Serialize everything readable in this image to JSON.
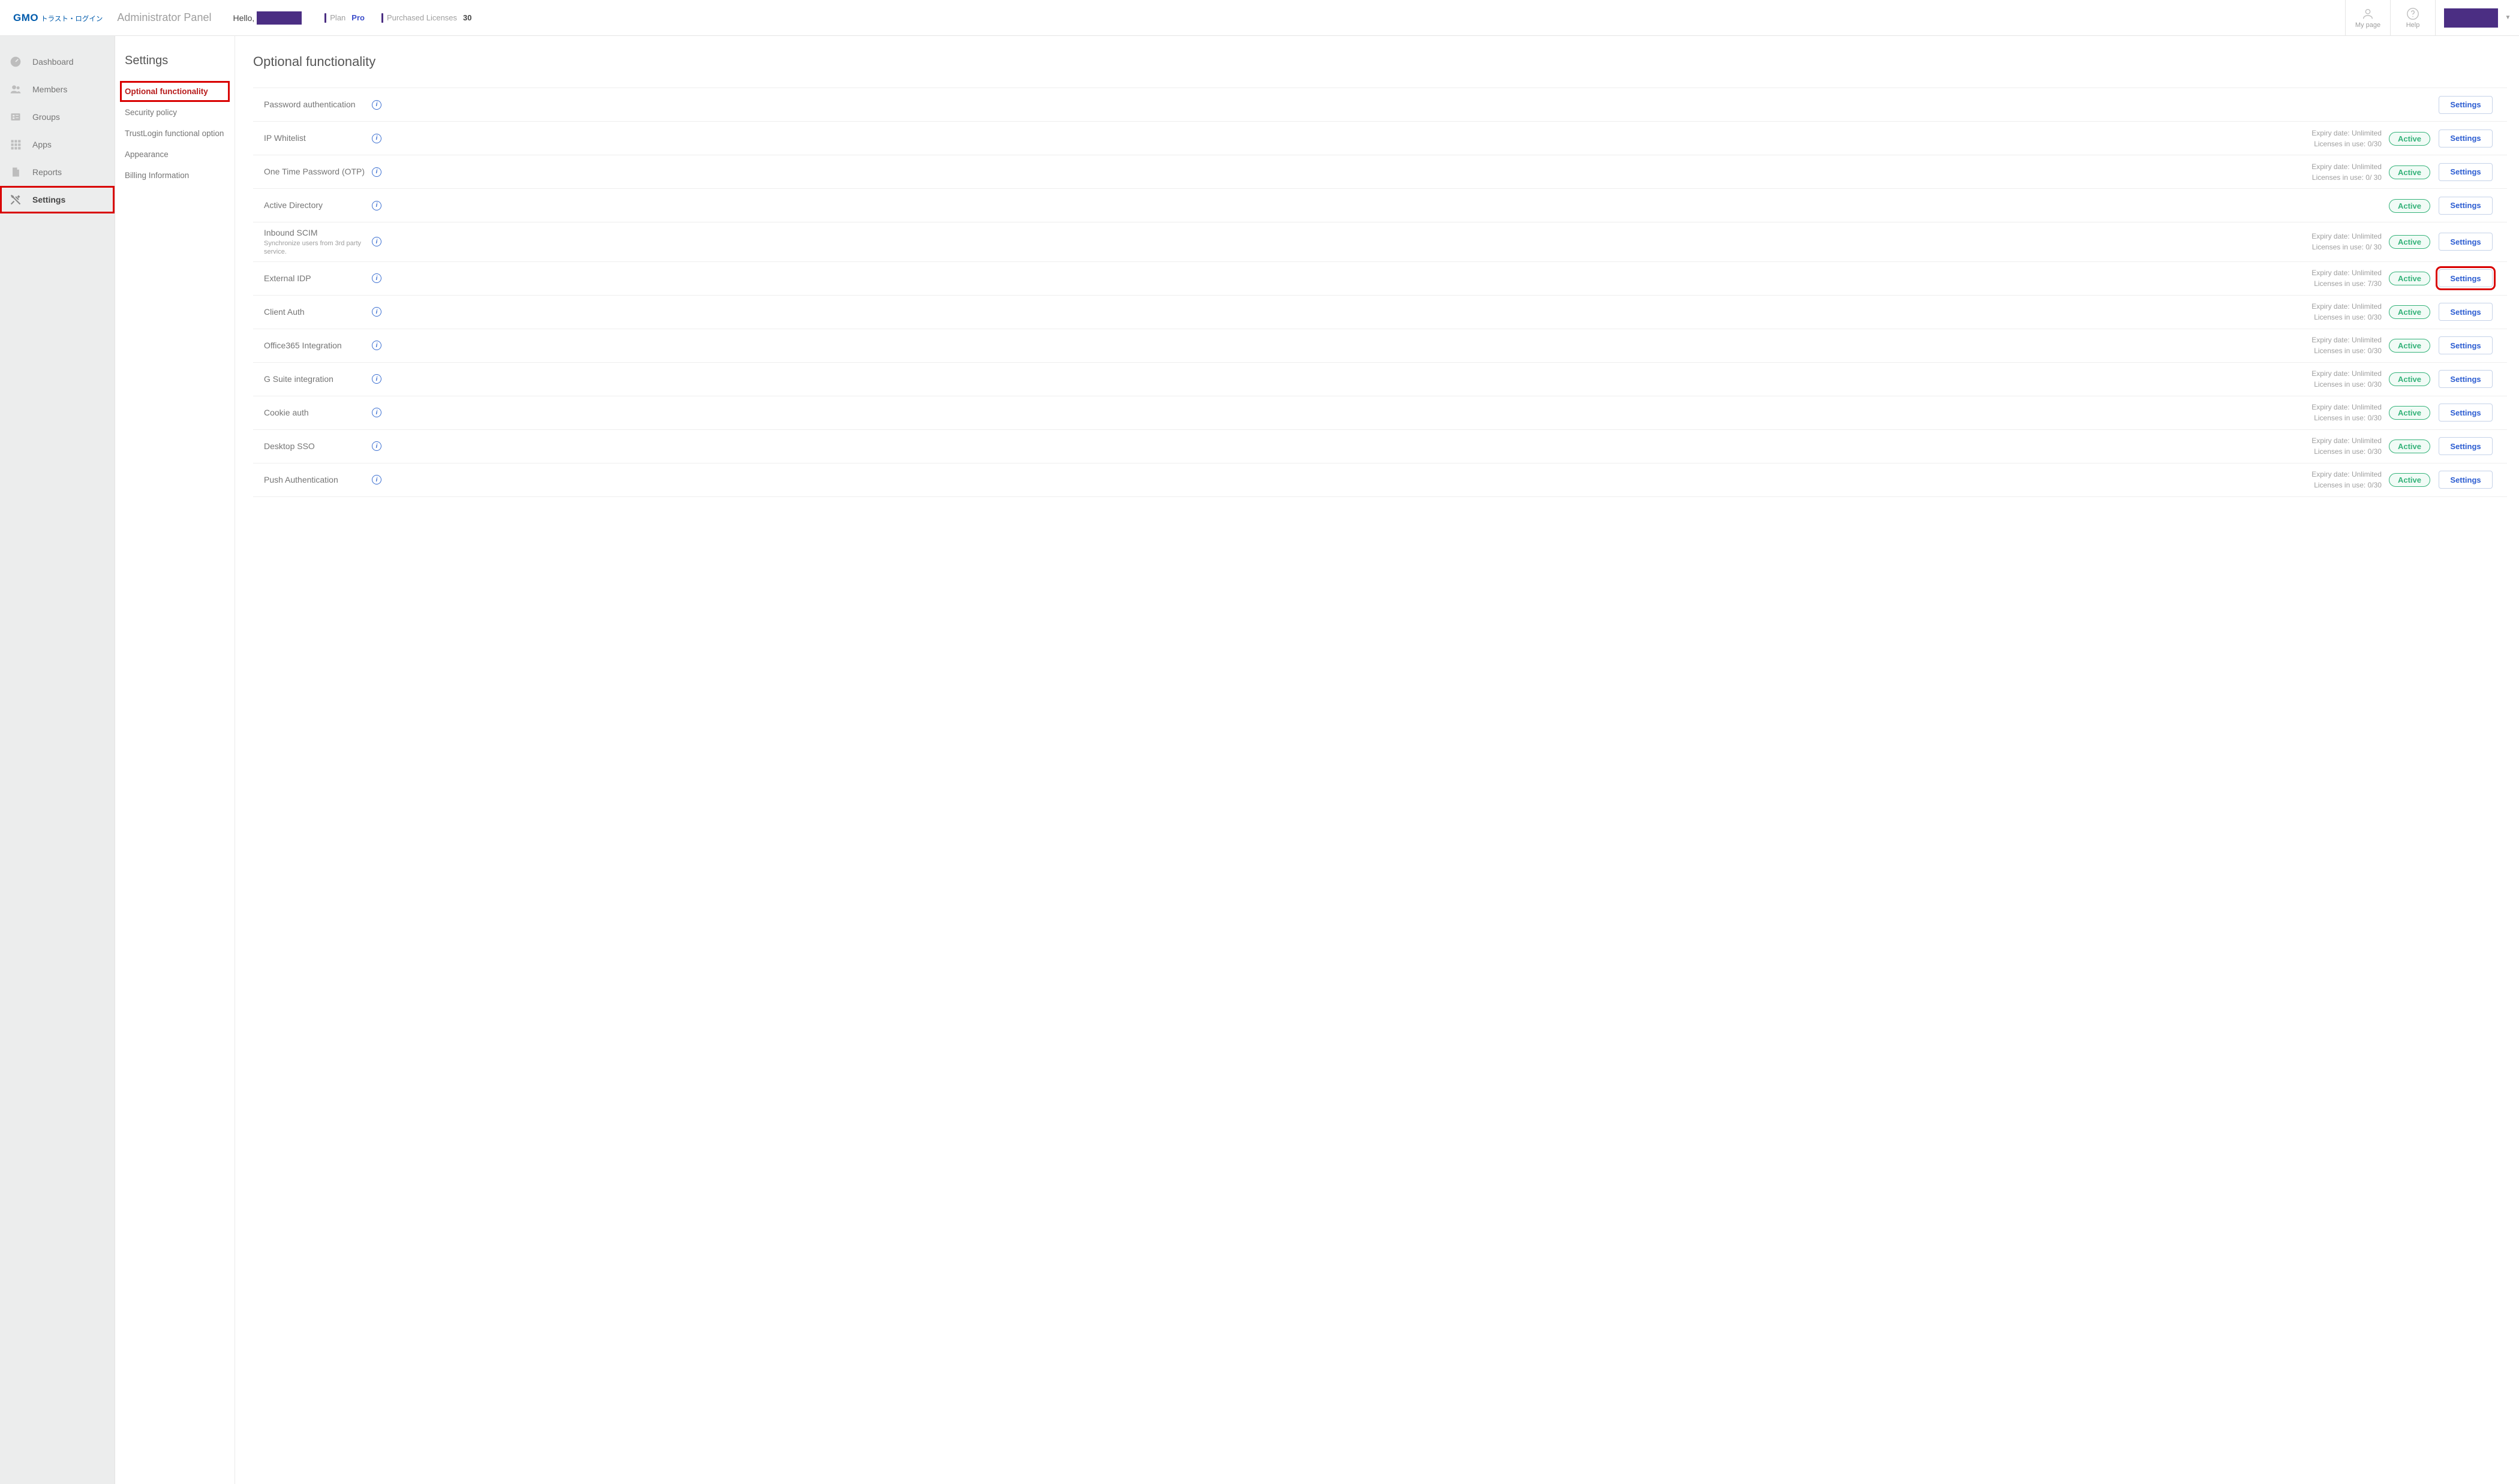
{
  "header": {
    "logo_gmo": "GMO",
    "logo_trust": "トラスト・ログイン",
    "admin_panel": "Administrator Panel",
    "hello": "Hello,",
    "plan_label": "Plan",
    "plan_value": "Pro",
    "licenses_label": "Purchased Licenses",
    "licenses_value": "30",
    "mypage": "My page",
    "help": "Help"
  },
  "nav": {
    "items": [
      {
        "label": "Dashboard"
      },
      {
        "label": "Members"
      },
      {
        "label": "Groups"
      },
      {
        "label": "Apps"
      },
      {
        "label": "Reports"
      },
      {
        "label": "Settings"
      }
    ]
  },
  "subnav": {
    "title": "Settings",
    "items": [
      {
        "label": "Optional functionality"
      },
      {
        "label": "Security policy"
      },
      {
        "label": "TrustLogin functional option"
      },
      {
        "label": "Appearance"
      },
      {
        "label": "Billing Information"
      }
    ]
  },
  "main": {
    "title": "Optional functionality",
    "settings_btn": "Settings",
    "active_badge": "Active",
    "rows": [
      {
        "title": "Password authentication",
        "subtitle": "",
        "meta": "",
        "active": false,
        "highlight": false
      },
      {
        "title": "IP Whitelist",
        "subtitle": "",
        "meta": "Expiry date: Unlimited\nLicenses in use: 0/30",
        "active": true,
        "highlight": false
      },
      {
        "title": "One Time Password (OTP)",
        "subtitle": "",
        "meta": "Expiry date: Unlimited\nLicenses in use: 0/ 30",
        "active": true,
        "highlight": false
      },
      {
        "title": "Active Directory",
        "subtitle": "",
        "meta": "",
        "active": true,
        "highlight": false
      },
      {
        "title": "Inbound SCIM",
        "subtitle": "Synchronize users from 3rd party service.",
        "meta": "Expiry date: Unlimited\nLicenses in use: 0/ 30",
        "active": true,
        "highlight": false
      },
      {
        "title": "External IDP",
        "subtitle": "",
        "meta": "Expiry date: Unlimited\nLicenses in use: 7/30",
        "active": true,
        "highlight": true
      },
      {
        "title": "Client Auth",
        "subtitle": "",
        "meta": "Expiry date: Unlimited\nLicenses in use: 0/30",
        "active": true,
        "highlight": false
      },
      {
        "title": "Office365 Integration",
        "subtitle": "",
        "meta": "Expiry date: Unlimited\nLicenses in use: 0/30",
        "active": true,
        "highlight": false
      },
      {
        "title": "G Suite integration",
        "subtitle": "",
        "meta": "Expiry date: Unlimited\nLicenses in use: 0/30",
        "active": true,
        "highlight": false
      },
      {
        "title": "Cookie auth",
        "subtitle": "",
        "meta": "Expiry date: Unlimited\nLicenses in use: 0/30",
        "active": true,
        "highlight": false
      },
      {
        "title": "Desktop SSO",
        "subtitle": "",
        "meta": "Expiry date: Unlimited\nLicenses in use: 0/30",
        "active": true,
        "highlight": false
      },
      {
        "title": "Push Authentication",
        "subtitle": "",
        "meta": "Expiry date: Unlimited\nLicenses in use: 0/30",
        "active": true,
        "highlight": false
      }
    ]
  }
}
